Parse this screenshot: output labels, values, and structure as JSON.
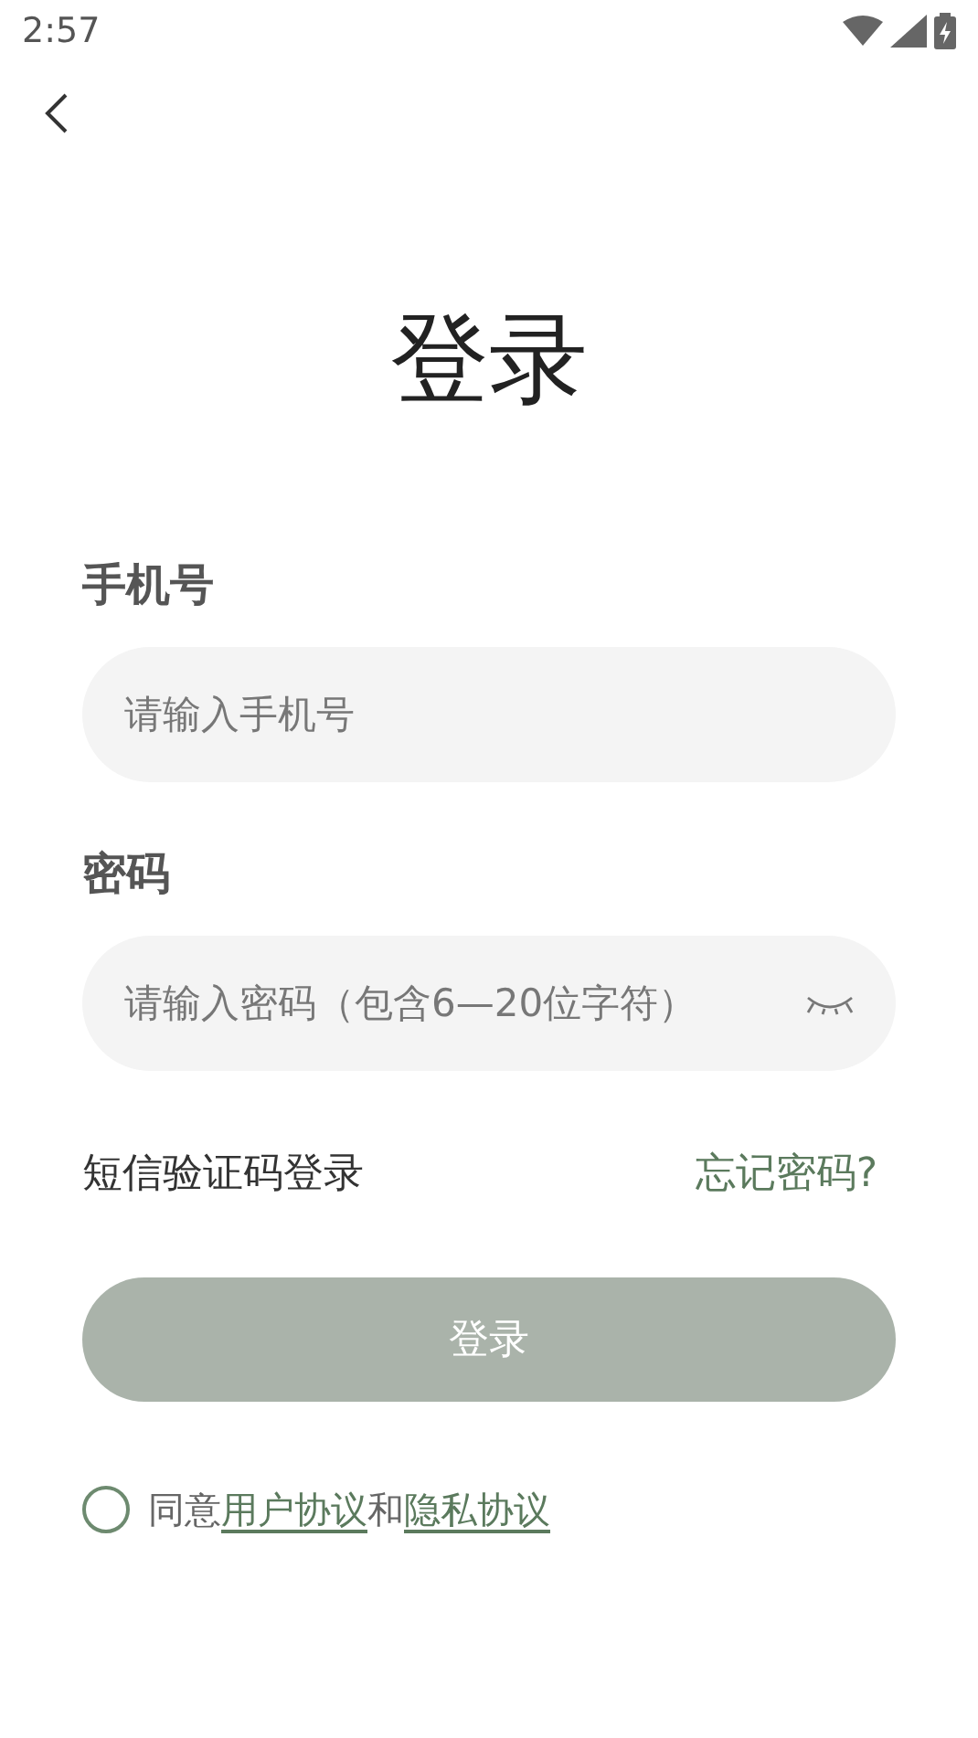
{
  "status_bar": {
    "time": "2:57"
  },
  "title": "登录",
  "phone": {
    "label": "手机号",
    "placeholder": "请输入手机号"
  },
  "password": {
    "label": "密码",
    "placeholder": "请输入密码（包含6—20位字符）",
    "visible": false
  },
  "sms_login": "短信验证码登录",
  "forgot": "忘记密码?",
  "login_button": {
    "label": "登录",
    "disabled": true
  },
  "agreement": {
    "checked": false,
    "parts": [
      {
        "kind": "text",
        "text": "同意"
      },
      {
        "kind": "link",
        "text": "用户协议"
      },
      {
        "kind": "text",
        "text": "和"
      },
      {
        "kind": "link",
        "text": "隐私协议"
      }
    ]
  }
}
